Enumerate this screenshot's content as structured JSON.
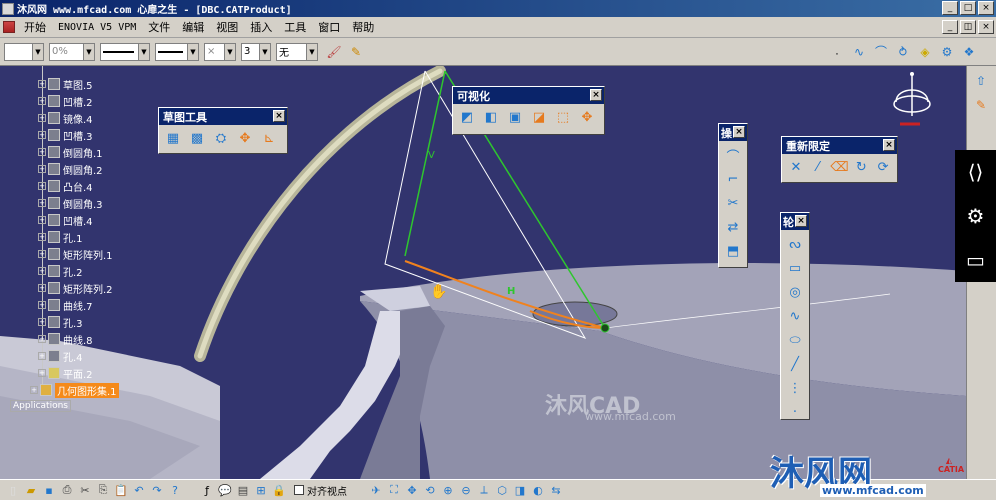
{
  "window": {
    "title": "沐风网 www.mfcad.com 心扉之生 - [DBC.CATProduct]"
  },
  "menu": {
    "items": [
      "开始",
      "ENOVIA V5 VPM",
      "文件",
      "编辑",
      "视图",
      "插入",
      "工具",
      "窗口",
      "帮助"
    ]
  },
  "toolbar_top": {
    "color_combo": "",
    "transparency_combo": "0%",
    "linetype_combo": "3",
    "layer_combo": "无"
  },
  "tree": {
    "items": [
      {
        "label": "草图.5"
      },
      {
        "label": "凹槽.2"
      },
      {
        "label": "镜像.4"
      },
      {
        "label": "凹槽.3"
      },
      {
        "label": "倒圆角.1"
      },
      {
        "label": "倒圆角.2"
      },
      {
        "label": "凸台.4"
      },
      {
        "label": "倒圆角.3"
      },
      {
        "label": "凹槽.4"
      },
      {
        "label": "孔.1"
      },
      {
        "label": "矩形阵列.1"
      },
      {
        "label": "孔.2"
      },
      {
        "label": "矩形阵列.2"
      },
      {
        "label": "曲线.7"
      },
      {
        "label": "孔.3"
      },
      {
        "label": "曲线.8"
      },
      {
        "label": "孔.4"
      },
      {
        "label": "平面.2"
      },
      {
        "label": "几何图形集.1"
      }
    ],
    "applications": "Applications"
  },
  "palettes": {
    "sketch_tools": {
      "title": "草图工具"
    },
    "visualization": {
      "title": "可视化"
    },
    "ops": {
      "title": "操"
    },
    "relimit": {
      "title": "重新限定"
    },
    "profile": {
      "title": "轮"
    }
  },
  "viewport": {
    "label_v": "V",
    "label_h": "H"
  },
  "toolbar_bottom": {
    "align_label": "对齐视点"
  },
  "watermark": {
    "center": "沐风CAD",
    "center_sub": "www.mfcad.com",
    "corner": "沐风网",
    "corner_sub": "www.mfcad.com",
    "catia": "CATIA"
  },
  "icons": [
    "share-icon",
    "gear-icon",
    "monitor-icon",
    "save-icon",
    "undo-icon",
    "redo-icon",
    "cut-icon",
    "copy-icon",
    "paste-icon",
    "zoom-icon",
    "pan-icon",
    "rotate-icon",
    "fit-all-icon",
    "compass-icon"
  ]
}
